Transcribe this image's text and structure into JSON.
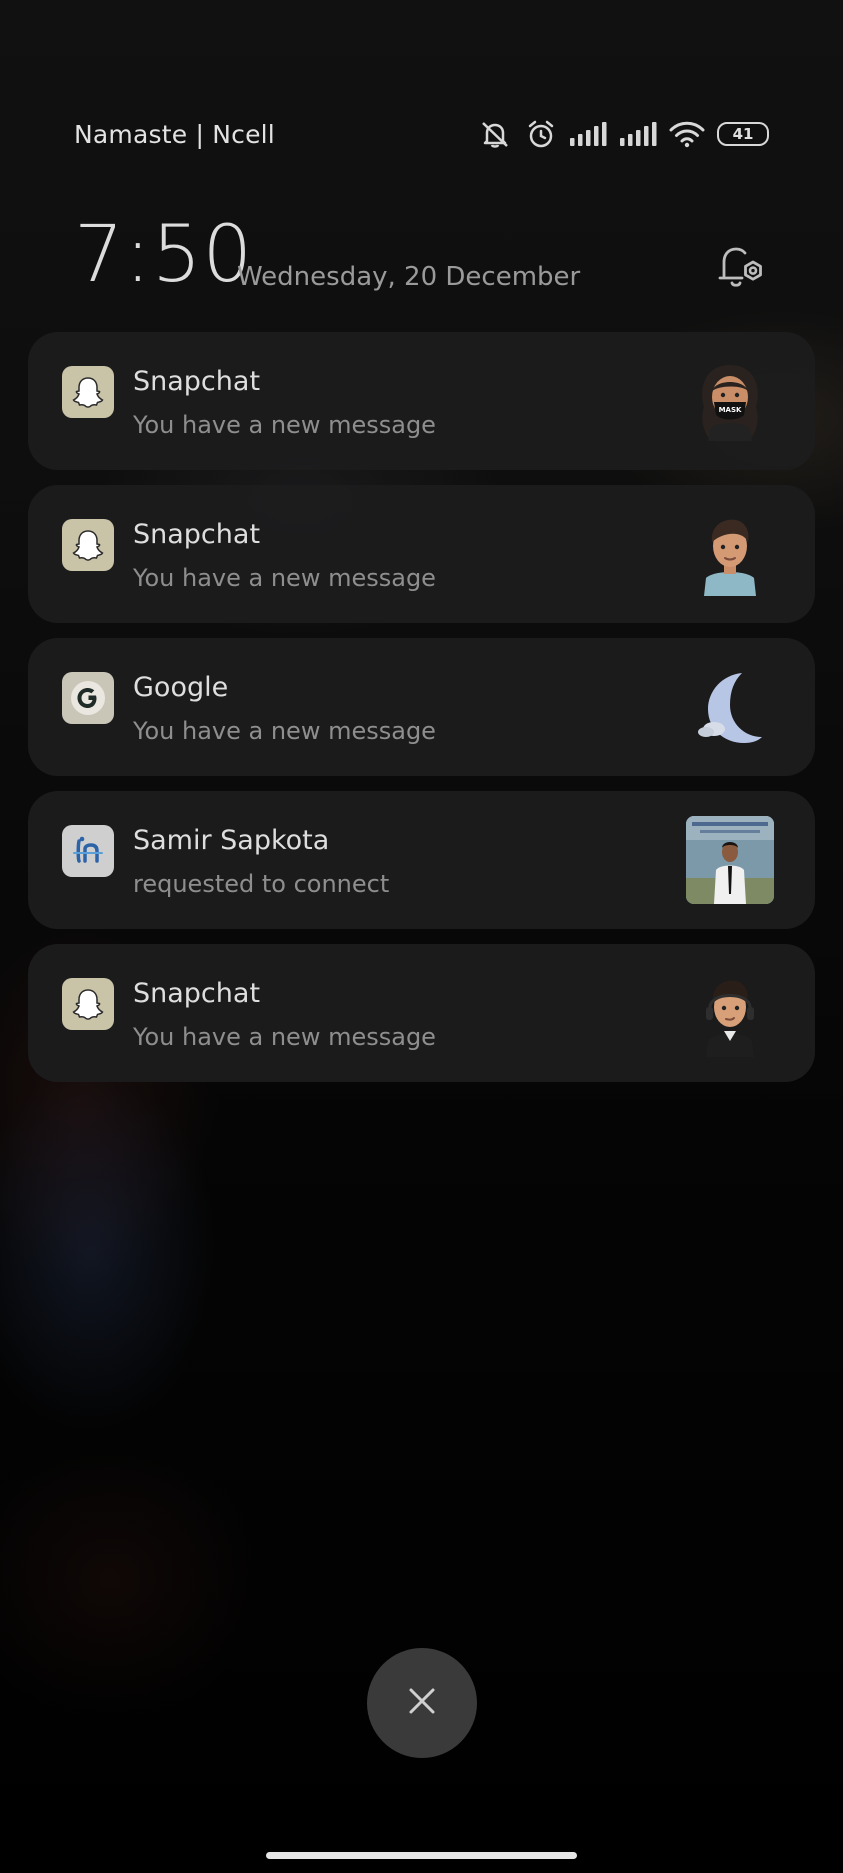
{
  "status_bar": {
    "carrier": "Namaste | Ncell",
    "battery": "41",
    "icons": [
      "silent-bell-icon",
      "alarm-icon",
      "signal-icon",
      "signal-icon",
      "wifi-icon",
      "battery-icon"
    ]
  },
  "lockscreen": {
    "time": "7:50",
    "date": "Wednesday, 20 December",
    "settings_icon": "notification-settings-icon"
  },
  "notifications": [
    {
      "app": "Snapchat",
      "text": "You have a new message",
      "app_icon": "snapchat-icon",
      "thumb": "bitmoji-mask-avatar"
    },
    {
      "app": "Snapchat",
      "text": "You have a new message",
      "app_icon": "snapchat-icon",
      "thumb": "bitmoji-male-avatar"
    },
    {
      "app": "Google",
      "text": "You have a new message",
      "app_icon": "google-icon",
      "thumb": "moon-icon"
    },
    {
      "app": "Samir Sapkota",
      "text": "requested to connect",
      "app_icon": "linkedin-icon",
      "thumb": "profile-photo"
    },
    {
      "app": "Snapchat",
      "text": "You have a new message",
      "app_icon": "snapchat-icon",
      "thumb": "bitmoji-headphones-avatar"
    }
  ],
  "controls": {
    "dismiss_icon": "close-icon"
  },
  "colors": {
    "card_background": "#1c1c1d",
    "dismiss_button": "#3a3a3a",
    "text_primary": "#dedede",
    "text_secondary": "#8e8e8e"
  }
}
